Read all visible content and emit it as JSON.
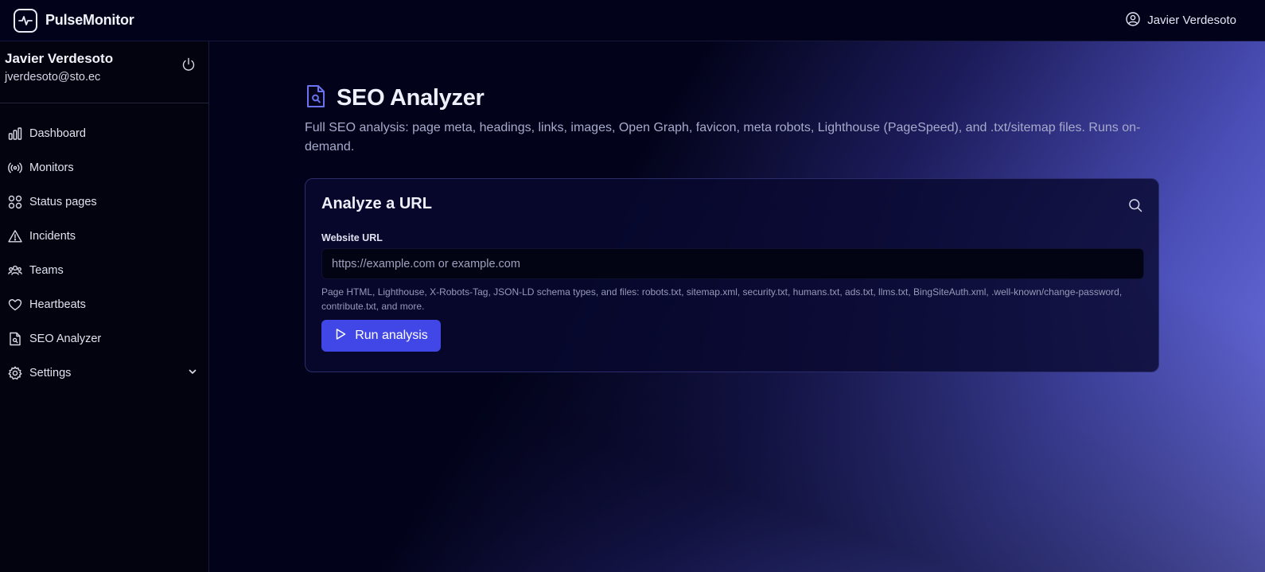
{
  "app": {
    "name": "PulseMonitor"
  },
  "header": {
    "user_name": "Javier Verdesoto"
  },
  "sidebar": {
    "profile": {
      "name": "Javier Verdesoto",
      "email": "jverdesoto@sto.ec"
    },
    "items": [
      {
        "label": "Dashboard",
        "icon": "bar-chart-icon"
      },
      {
        "label": "Monitors",
        "icon": "broadcast-icon"
      },
      {
        "label": "Status pages",
        "icon": "grid-icon"
      },
      {
        "label": "Incidents",
        "icon": "alert-triangle-icon"
      },
      {
        "label": "Teams",
        "icon": "users-icon"
      },
      {
        "label": "Heartbeats",
        "icon": "heart-icon"
      },
      {
        "label": "SEO Analyzer",
        "icon": "file-search-icon"
      },
      {
        "label": "Settings",
        "icon": "gear-icon"
      }
    ]
  },
  "page": {
    "title": "SEO Analyzer",
    "description": "Full SEO analysis: page meta, headings, links, images, Open Graph, favicon, meta robots, Lighthouse (PageSpeed), and .txt/sitemap files. Runs on-demand."
  },
  "card": {
    "title": "Analyze a URL",
    "field_label": "Website URL",
    "input_placeholder": "https://example.com or example.com",
    "input_value": "",
    "hint": "Page HTML, Lighthouse, X-Robots-Tag, JSON-LD schema types, and files: robots.txt, sitemap.xml, security.txt, humans.txt, ads.txt, llms.txt, BingSiteAuth.xml, .well-known/change-password, contribute.txt, and more.",
    "button_label": "Run analysis"
  },
  "colors": {
    "accent": "#4147e6",
    "background": "#02031a",
    "gradient_end": "#7478ea"
  }
}
